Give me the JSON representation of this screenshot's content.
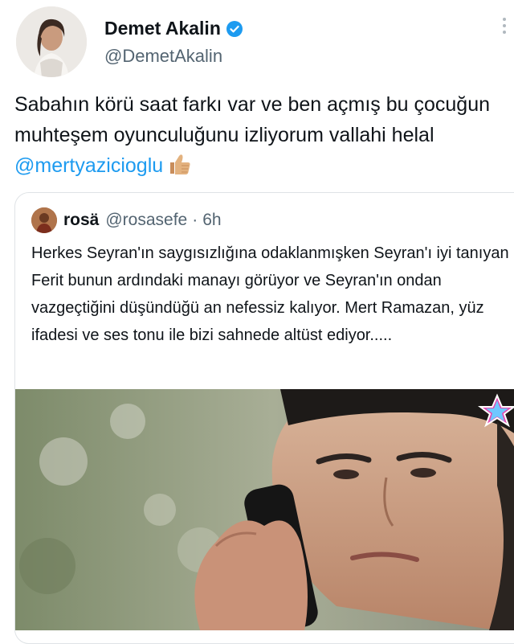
{
  "author": {
    "name": "Demet Akalin",
    "handle": "@DemetAkalin",
    "verified": true
  },
  "tweet": {
    "text_part1": "Sabahın körü saat farkı var ve ben açmış bu çocuğun muhteşem oyunculuğunu izliyorum vallahi helal ",
    "mention": "@mertyazicioglu",
    "emoji": "thumbs-up-icon"
  },
  "quoted": {
    "name": "rosä",
    "handle": "@rosasefe",
    "separator": "·",
    "time": "6h",
    "text": "Herkes Seyran'ın saygısızlığına odaklanmışken Seyran'ı iyi tanıyan Ferit bunun ardındaki manayı görüyor ve Seyran'ın ondan vazgeçtiğini düşündüğü an nefessiz kalıyor. Mert Ramazan, yüz ifadesi ve ses tonu ile bizi sahnede altüst ediyor.....",
    "media": "video-still-man-on-phone"
  },
  "colors": {
    "link": "#1d9bf0",
    "verified": "#1d9bf0",
    "secondary_text": "#536471"
  }
}
